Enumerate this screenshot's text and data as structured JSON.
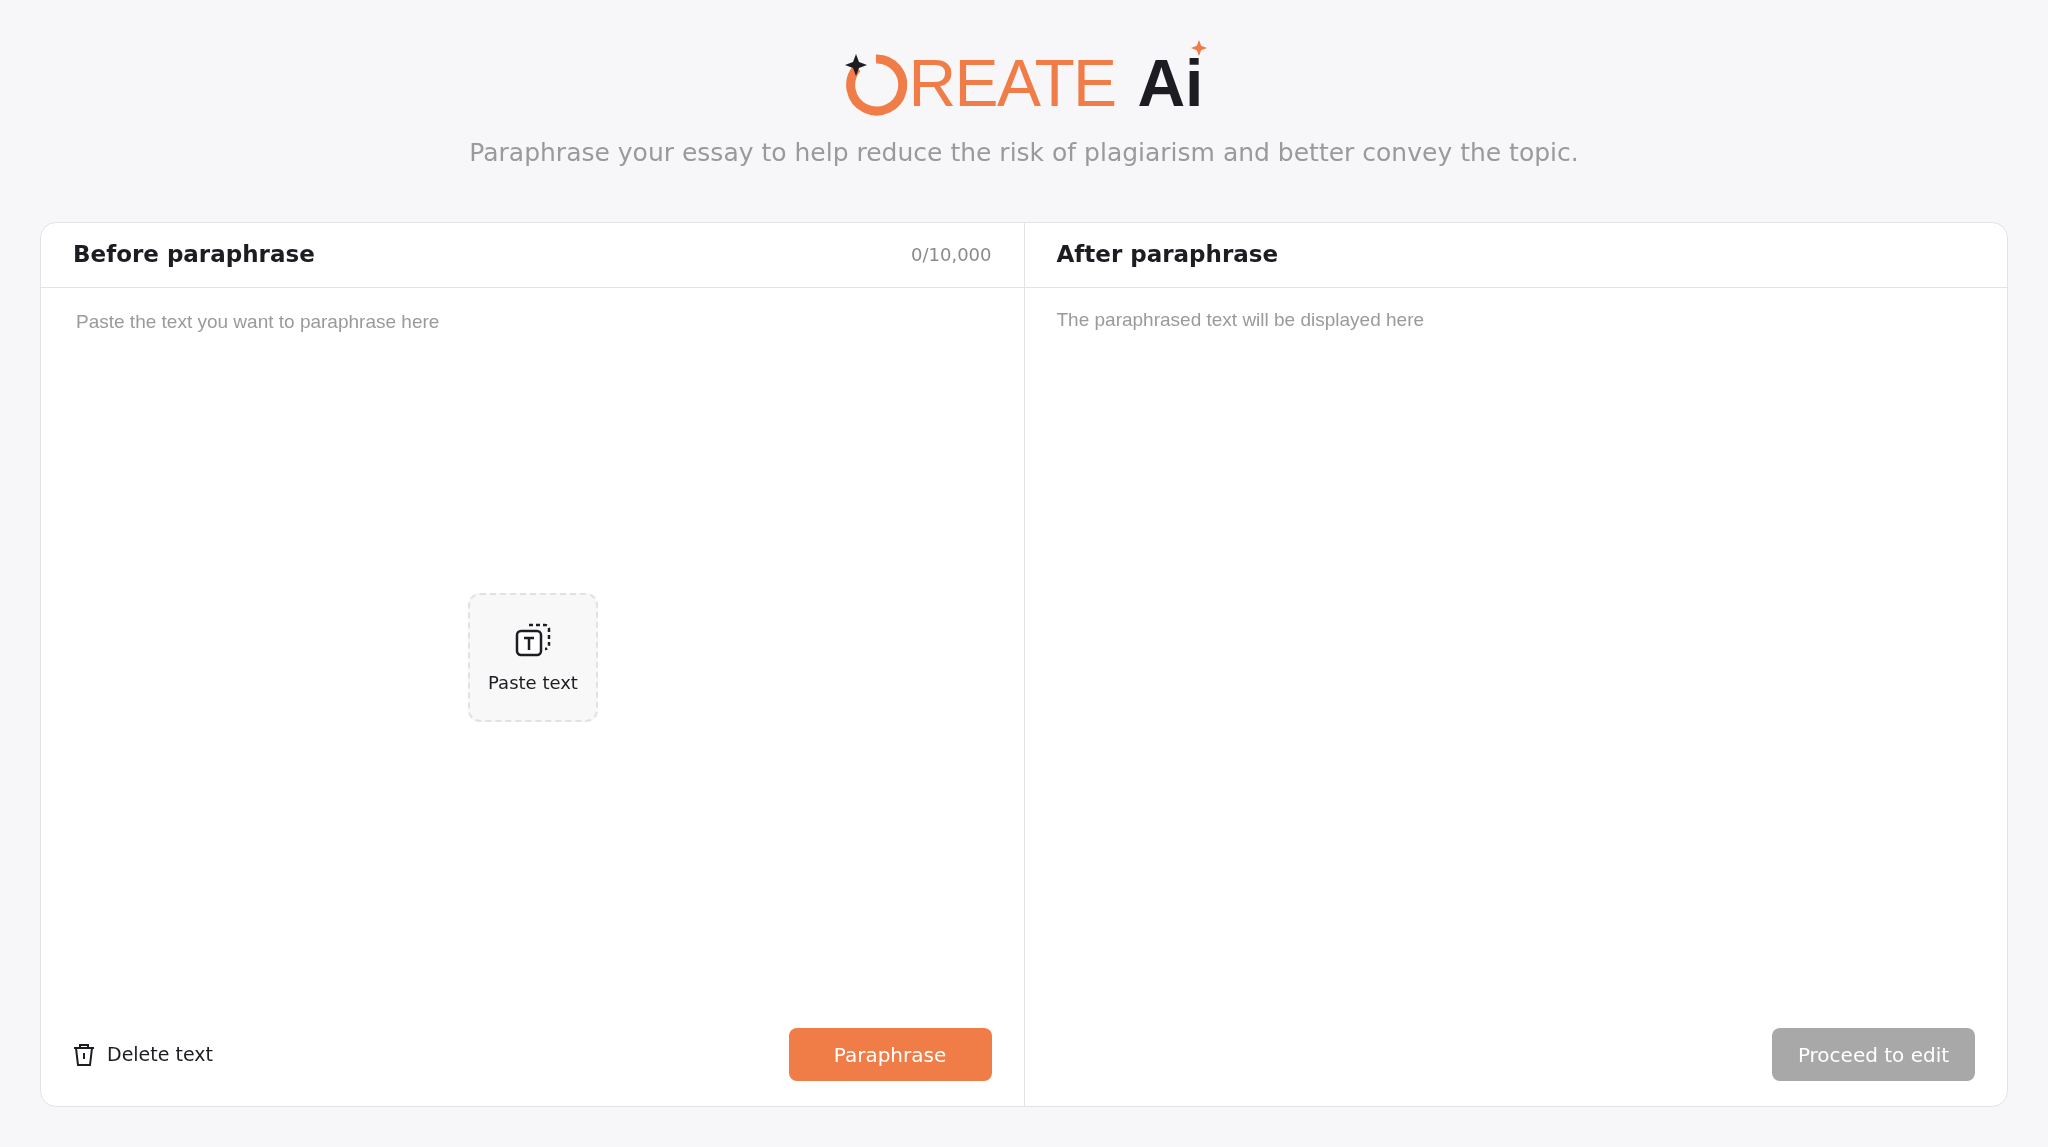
{
  "logo": {
    "brand": "REATE",
    "suffix": "Ai"
  },
  "subtitle": "Paraphrase your essay to help reduce the risk of plagiarism and better convey the topic.",
  "input_panel": {
    "title": "Before paraphrase",
    "counter": "0/10,000",
    "placeholder": "Paste the text you want to paraphrase here",
    "paste_button": "Paste text",
    "delete_button": "Delete text",
    "submit_button": {
      "label": "Paraphrase",
      "disabled": false
    }
  },
  "output_panel": {
    "title": "After paraphrase",
    "placeholder": "The paraphrased text will be displayed here",
    "proceed_button": {
      "label": "Proceed to edit",
      "disabled": true
    }
  }
}
